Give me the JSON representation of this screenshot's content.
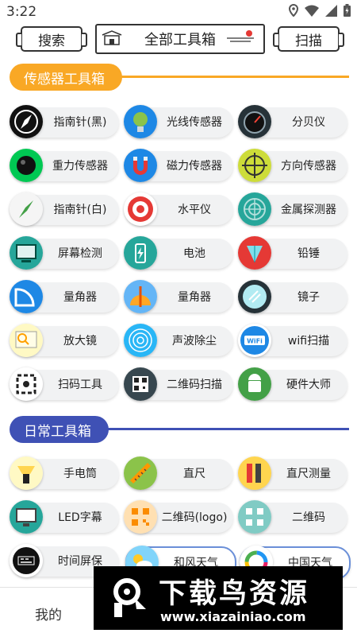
{
  "status_bar": {
    "time": "3:22"
  },
  "top_bar": {
    "search_label": "搜索",
    "title": "全部工具箱",
    "scan_label": "扫描"
  },
  "colors": {
    "sensor_section": "#f9a825",
    "daily_section": "#3f51b5"
  },
  "sensor_section": {
    "title": "传感器工具箱",
    "tools": [
      {
        "label": "指南针(黑)",
        "icon": "black-compass-icon"
      },
      {
        "label": "光线传感器",
        "icon": "light-bulb-globe-icon"
      },
      {
        "label": "分贝仪",
        "icon": "decibel-gauge-icon"
      },
      {
        "label": "重力传感器",
        "icon": "gravity-ball-icon"
      },
      {
        "label": "磁力传感器",
        "icon": "magnet-icon"
      },
      {
        "label": "方向传感器",
        "icon": "crosshair-icon"
      },
      {
        "label": "指南针(白)",
        "icon": "white-compass-icon"
      },
      {
        "label": "水平仪",
        "icon": "target-level-icon"
      },
      {
        "label": "金属探测器",
        "icon": "radar-icon"
      },
      {
        "label": "屏幕检测",
        "icon": "screen-monitor-icon"
      },
      {
        "label": "电池",
        "icon": "battery-icon"
      },
      {
        "label": "铅锤",
        "icon": "plumb-bob-icon"
      },
      {
        "label": "量角器",
        "icon": "protractor-blue-icon"
      },
      {
        "label": "量角器",
        "icon": "protractor-orange-icon"
      },
      {
        "label": "镜子",
        "icon": "mirror-icon"
      },
      {
        "label": "放大镜",
        "icon": "magnifier-icon"
      },
      {
        "label": "声波除尘",
        "icon": "sound-wave-icon"
      },
      {
        "label": "wifi扫描",
        "icon": "wifi-icon"
      },
      {
        "label": "扫码工具",
        "icon": "scan-code-icon"
      },
      {
        "label": "二维码扫描",
        "icon": "qr-scan-icon"
      },
      {
        "label": "硬件大师",
        "icon": "android-icon"
      }
    ]
  },
  "daily_section": {
    "title": "日常工具箱",
    "tools": [
      {
        "label": "手电筒",
        "icon": "flashlight-icon"
      },
      {
        "label": "直尺",
        "icon": "ruler-icon"
      },
      {
        "label": "直尺测量",
        "icon": "ruler-measure-icon"
      },
      {
        "label": "LED字幕",
        "icon": "led-monitor-icon"
      },
      {
        "label": "二维码(logo)",
        "icon": "qr-logo-icon"
      },
      {
        "label": "二维码",
        "icon": "qr-code-icon"
      },
      {
        "label": "时间屏保",
        "icon": "clock-screensaver-icon"
      },
      {
        "label": "和风天气",
        "icon": "weather-sun-cloud-icon"
      },
      {
        "label": "中国天气",
        "icon": "colorful-ring-icon"
      }
    ]
  },
  "bottom_nav": {
    "mine_label": "我的"
  },
  "watermark": {
    "title": "下载鸟资源",
    "url": "www.xiazainiao.com"
  }
}
